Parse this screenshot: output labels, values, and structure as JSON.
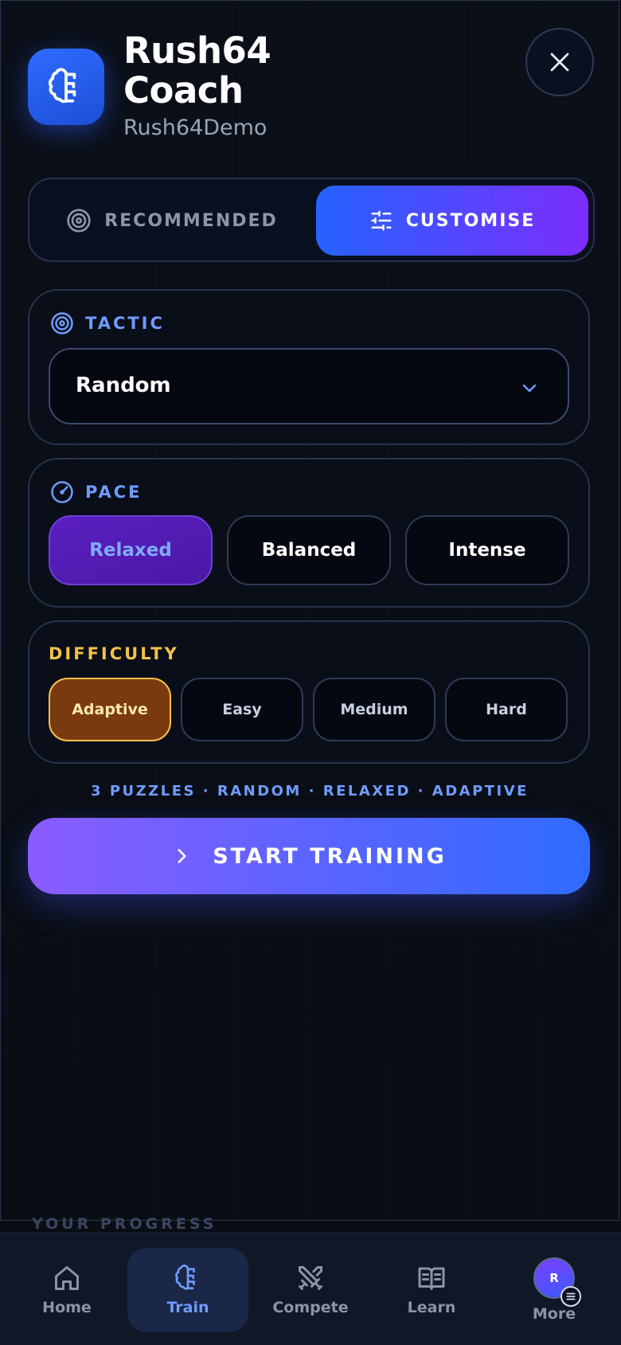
{
  "header": {
    "title": "Rush64 Coach",
    "subtitle": "Rush64Demo",
    "app_icon": "brain-icon",
    "close_icon": "close-icon"
  },
  "mode_toggle": {
    "recommended_label": "RECOMMENDED",
    "customise_label": "CUSTOMISE",
    "selected": "CUSTOMISE"
  },
  "tactic": {
    "label": "TACTIC",
    "value": "Random"
  },
  "pace": {
    "label": "PACE",
    "options": [
      "Relaxed",
      "Balanced",
      "Intense"
    ],
    "selected": "Relaxed"
  },
  "difficulty": {
    "label": "DIFFICULTY",
    "options": [
      "Adaptive",
      "Easy",
      "Medium",
      "Hard"
    ],
    "selected": "Adaptive"
  },
  "summary": "3 PUZZLES · RANDOM · RELAXED · ADAPTIVE",
  "start_button": "START TRAINING",
  "progress_heading": "YOUR PROGRESS",
  "nav": {
    "items": [
      {
        "label": "Home",
        "icon": "home-icon"
      },
      {
        "label": "Train",
        "icon": "brain-icon"
      },
      {
        "label": "Compete",
        "icon": "swords-icon"
      },
      {
        "label": "Learn",
        "icon": "book-icon"
      },
      {
        "label": "More",
        "icon": "avatar"
      }
    ],
    "active": "Train",
    "avatar_initial": "R"
  },
  "colors": {
    "accent_blue": "#2563ff",
    "accent_purple": "#7c2dff",
    "tactic_label": "#6f9cff",
    "difficulty_label": "#f2c14a",
    "pace_active": "#4a18a6",
    "difficulty_active": "#7a3a10"
  }
}
